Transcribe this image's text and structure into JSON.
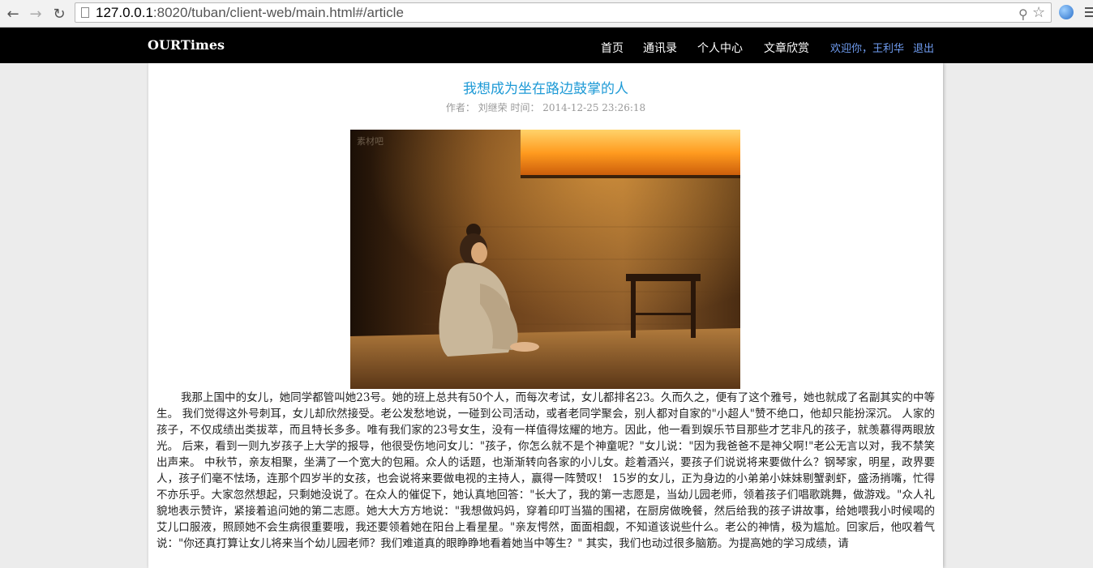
{
  "browser": {
    "url_host": "127.0.0.1",
    "url_rest": ":8020/tuban/client-web/main.html#/article"
  },
  "site": {
    "brand": "OURTimes",
    "nav": [
      "首页",
      "通讯录",
      "个人中心",
      "文章欣赏"
    ],
    "welcome": "欢迎你，王利华",
    "logout": "退出"
  },
  "article": {
    "title": "我想成为坐在路边鼓掌的人",
    "meta": "作者：  刘继荣 时间：  2014-12-25 23:26:18",
    "watermark": "素材吧",
    "body": "我那上国中的女儿，她同学都管叫她23号。她的班上总共有50个人，而每次考试，女儿都排名23。久而久之，便有了这个雅号，她也就成了名副其实的中等生。 我们觉得这外号刺耳，女儿却欣然接受。老公发愁地说，一碰到公司活动，或者老同学聚会，别人都对自家的\"小超人\"赞不绝口，他却只能扮深沉。 人家的孩子，不仅成绩出类拔萃，而且特长多多。唯有我们家的23号女生，没有一样值得炫耀的地方。因此，他一看到娱乐节目那些才艺非凡的孩子，就羡慕得两眼放光。 后来，看到一则九岁孩子上大学的报导，他很受伤地问女儿：\"孩子，你怎么就不是个神童呢？\"女儿说：\"因为我爸爸不是神父啊!\"老公无言以对，我不禁笑出声来。 中秋节，亲友相聚，坐满了一个宽大的包厢。众人的话题，也渐渐转向各家的小儿女。趁着酒兴，要孩子们说说将来要做什么？钢琴家，明星，政界要人，孩子们毫不怯场，连那个四岁半的女孩，也会说将来要做电视的主持人，赢得一阵赞叹！ 15岁的女儿，正为身边的小弟弟小妹妹剔蟹剥虾，盛汤捎嘴，忙得不亦乐乎。大家忽然想起，只剩她没说了。在众人的催促下，她认真地回答：\"长大了，我的第一志愿是，当幼儿园老师，领着孩子们唱歌跳舞，做游戏。\"众人礼貌地表示赞许，紧接着追问她的第二志愿。她大大方方地说：\"我想做妈妈，穿着印叮当猫的围裙，在厨房做晚餐，然后给我的孩子讲故事，给她喂我小时候喝的艾儿口服液，照顾她不会生病很重要哦，我还要领着她在阳台上看星星。\"亲友愕然，面面相觑，不知道该说些什么。老公的神情，极为尴尬。回家后，他叹着气说：\"你还真打算让女儿将来当个幼儿园老师？我们难道真的眼睁睁地看着她当中等生？\" 其实，我们也动过很多脑筋。为提高她的学习成绩，请"
  }
}
